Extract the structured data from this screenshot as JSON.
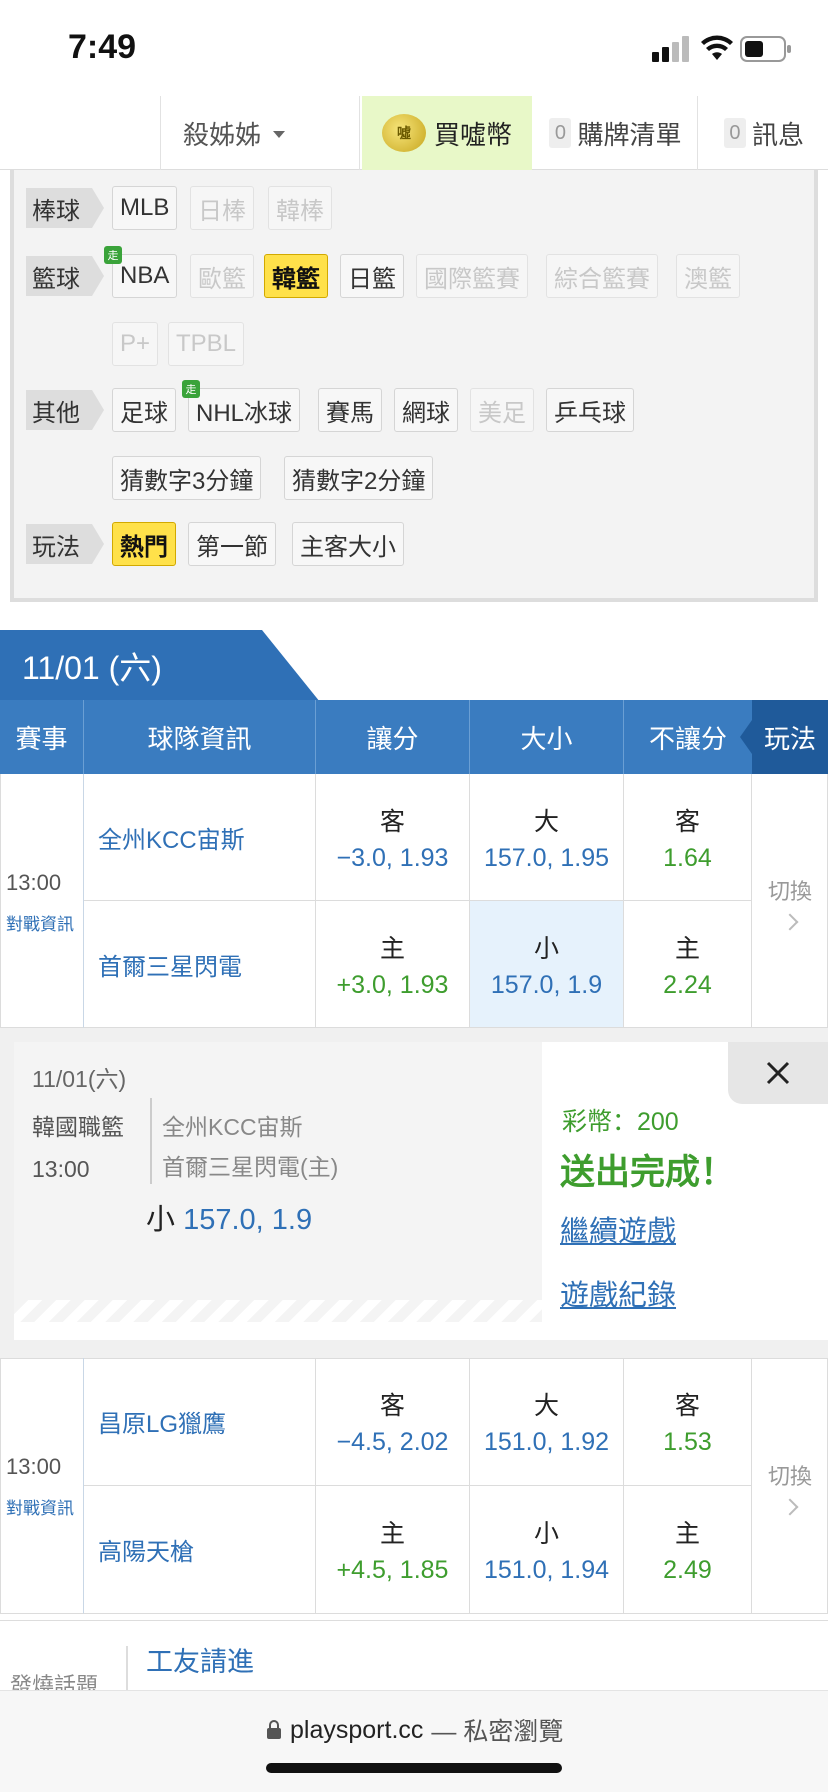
{
  "status_bar": {
    "time": "7:49"
  },
  "nav": {
    "user": "殺姊姊",
    "buy_label": "買噓幣",
    "buy_coin_glyph": "噓",
    "cart_count": "0",
    "cart_label": "購牌清單",
    "msg_count": "0",
    "msg_label": "訊息"
  },
  "filters": {
    "baseball": {
      "label": "棒球",
      "items": [
        "MLB",
        "日棒",
        "韓棒"
      ]
    },
    "basketball": {
      "label": "籃球",
      "items": [
        "NBA",
        "歐籃",
        "韓籃",
        "日籃",
        "國際籃賽",
        "綜合籃賽",
        "澳籃",
        "P+",
        "TPBL"
      ]
    },
    "other": {
      "label": "其他",
      "items": [
        "足球",
        "NHL冰球",
        "賽馬",
        "網球",
        "美足",
        "乒乓球",
        "猜數字3分鐘",
        "猜數字2分鐘"
      ]
    },
    "play": {
      "label": "玩法",
      "items": [
        "熱門",
        "第一節",
        "主客大小"
      ]
    },
    "walk_badge": "走"
  },
  "date_tab": "11/01 (六)",
  "table": {
    "headers": [
      "賽事",
      "球隊資訊",
      "讓分",
      "大小",
      "不讓分",
      "玩法"
    ],
    "switch_label": "切換",
    "matchup_label": "對戰資訊",
    "games": [
      {
        "time": "13:00",
        "away": {
          "team": "全州KCC宙斯",
          "spread_side": "客",
          "spread": "−3.0, 1.93",
          "ou_side": "大",
          "ou": "157.0, 1.95",
          "ml_side": "客",
          "ml": "1.64"
        },
        "home": {
          "team": "首爾三星閃電",
          "spread_side": "主",
          "spread": "+3.0, 1.93",
          "ou_side": "小",
          "ou": "157.0, 1.9",
          "ml_side": "主",
          "ml": "2.24"
        }
      },
      {
        "time": "13:00",
        "away": {
          "team": "昌原LG獵鷹",
          "spread_side": "客",
          "spread": "−4.5, 2.02",
          "ou_side": "大",
          "ou": "151.0, 1.92",
          "ml_side": "客",
          "ml": "1.53"
        },
        "home": {
          "team": "高陽天槍",
          "spread_side": "主",
          "spread": "+4.5, 1.85",
          "ou_side": "小",
          "ou": "151.0, 1.94",
          "ml_side": "主",
          "ml": "2.49"
        }
      }
    ]
  },
  "popup": {
    "date": "11/01(六)",
    "league": "韓國職籃",
    "time": "13:00",
    "away_team": "全州KCC宙斯",
    "home_team": "首爾三星閃電(主)",
    "pick_side": "小",
    "pick_value": "157.0, 1.9",
    "coins": "彩幣：200",
    "done": "送出完成！",
    "continue": "繼續遊戲",
    "history": "遊戲紀錄"
  },
  "forum": {
    "left": "發燒話題",
    "title": "工友請進"
  },
  "address_bar": {
    "domain": "playsport.cc",
    "mode": "— 私密瀏覽"
  },
  "colors": {
    "primary": "#2f70b6",
    "accent_yellow": "#ffe14a",
    "green": "#3e9d2e",
    "buy_bg": "#e8f8c8"
  }
}
